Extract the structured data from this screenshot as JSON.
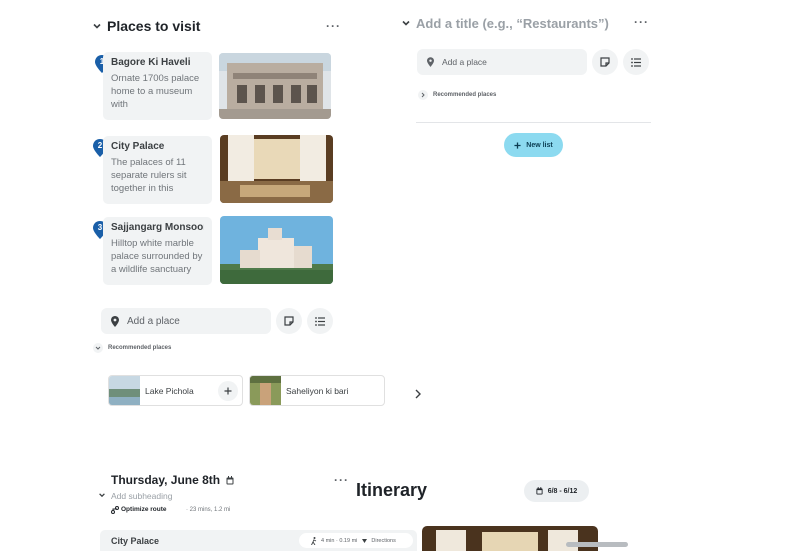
{
  "places_section": {
    "title": "Places to visit",
    "menu": "···",
    "places": [
      {
        "number": "1",
        "name": "Bagore Ki Haveli",
        "description": "Ornate 1700s palace home to a museum with"
      },
      {
        "number": "2",
        "name": "City Palace",
        "description": "The palaces of 11 separate rulers sit together in this"
      },
      {
        "number": "3",
        "name": "Sajjangarg Monsoon Pa",
        "description": "Hilltop white marble palace surrounded by a wildlife sanctuary"
      }
    ],
    "add_place_placeholder": "Add a place",
    "recommended_label": "Recommended places",
    "recommended": [
      {
        "name": "Lake Pichola"
      },
      {
        "name": "Saheliyon ki bari"
      }
    ]
  },
  "new_list_section": {
    "title_placeholder": "Add a title (e.g., “Restaurants”)",
    "menu": "···",
    "add_place_placeholder": "Add a place",
    "recommended_label": "Recommended places",
    "new_list_label": "New list"
  },
  "itinerary": {
    "title": "Itinerary",
    "date_range": "6/8 - 6/12",
    "day": {
      "title": "Thursday, June 8th",
      "menu": "···",
      "subheading_placeholder": "Add subheading",
      "optimize_label": "Optimize route",
      "route_summary": "· 23 mins, 1.2 mi",
      "first_stop": {
        "name": "City Palace",
        "travel": "4 min · 0.19 mi",
        "directions_label": "Directions"
      }
    }
  },
  "colors": {
    "pin": "#1a5fa8",
    "accent_button": "#8cdaf0"
  }
}
